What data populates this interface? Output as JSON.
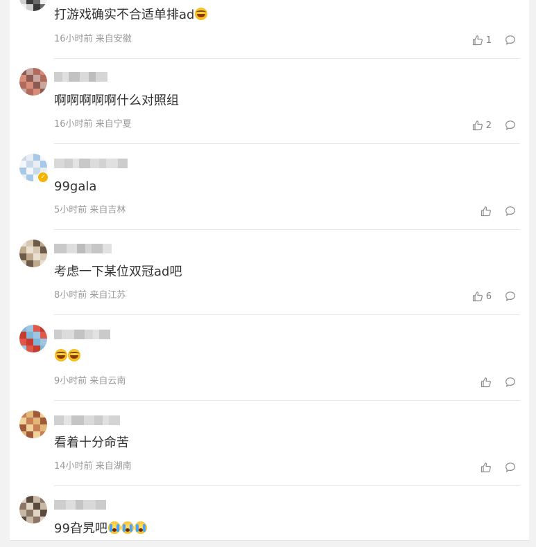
{
  "comments": [
    {
      "text": "打游戏确实不合适单排ad",
      "emojis": [
        "laugh"
      ],
      "time": "16小时前",
      "location": "来自安徽",
      "likes": "1"
    },
    {
      "text": "啊啊啊啊啊什么对照组",
      "emojis": [],
      "time": "16小时前",
      "location": "来自宁夏",
      "likes": "2"
    },
    {
      "text": "99gala",
      "emojis": [],
      "time": "5小时前",
      "location": "来自吉林",
      "likes": ""
    },
    {
      "text": "考虑一下某位双冠ad吧",
      "emojis": [],
      "time": "8小时前",
      "location": "来自江苏",
      "likes": "6"
    },
    {
      "text": "",
      "emojis": [
        "laugh",
        "laugh"
      ],
      "time": "9小时前",
      "location": "来自云南",
      "likes": ""
    },
    {
      "text": "看着十分命苦",
      "emojis": [],
      "time": "14小时前",
      "location": "来自湖南",
      "likes": ""
    },
    {
      "text": "99旮旯吧",
      "emojis": [
        "cry",
        "cry",
        "cry"
      ],
      "time": "",
      "location": "",
      "likes": ""
    }
  ],
  "colors": {
    "text": "#333333",
    "meta": "#999999",
    "divider": "#e6e6e6",
    "icon": "#8a8a8a",
    "background": "#f2f2f2"
  },
  "icons": {
    "like": "thumbs-up-icon",
    "reply": "comment-bubble-icon",
    "verified": "verified-badge-icon"
  }
}
